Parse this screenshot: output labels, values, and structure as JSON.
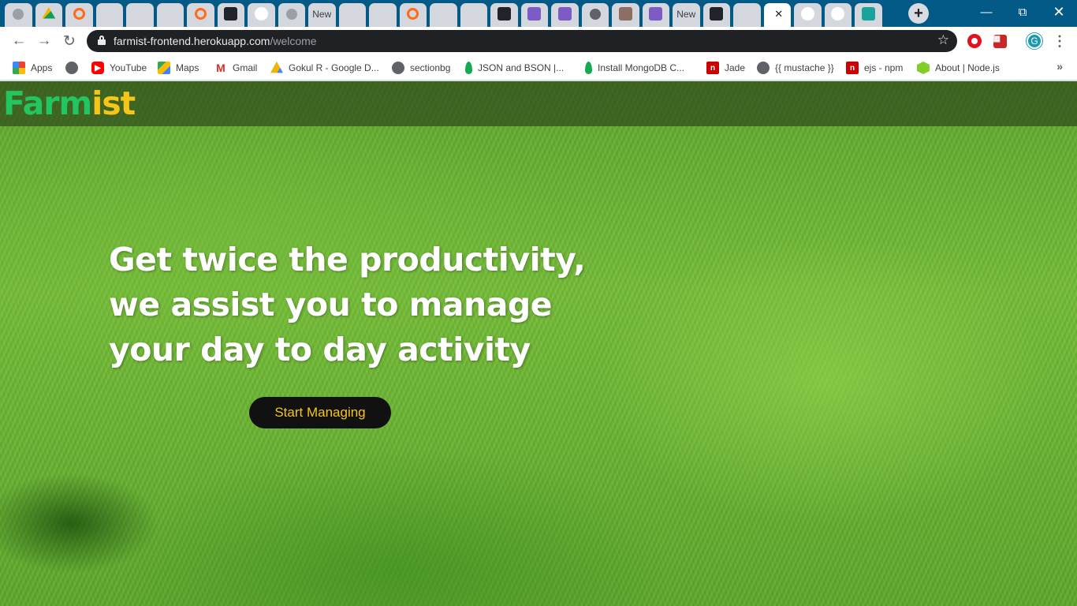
{
  "tabs": [
    {
      "icon": "globe-icon",
      "color": "#9aa0a6",
      "glyph": ""
    },
    {
      "icon": "drive-icon",
      "color": "#f4b400",
      "glyph": ""
    },
    {
      "icon": "codepen-orange-icon",
      "color": "#ff6b1a",
      "glyph": ""
    },
    {
      "icon": "gmail-icon",
      "color": "#d93025",
      "glyph": "M"
    },
    {
      "icon": "gmail-icon",
      "color": "#d93025",
      "glyph": "M"
    },
    {
      "icon": "gmail-icon",
      "color": "#d93025",
      "glyph": "M"
    },
    {
      "icon": "codepen-orange-icon",
      "color": "#ff6b1a",
      "glyph": ""
    },
    {
      "icon": "react-dark-icon",
      "color": "#20232a",
      "glyph": "⚛"
    },
    {
      "icon": "google-icon",
      "color": "#ffffff",
      "glyph": "G"
    },
    {
      "icon": "globe-icon",
      "color": "#9aa0a6",
      "glyph": ""
    },
    {
      "icon": "new-tab",
      "color": "",
      "glyph": "",
      "text": "New"
    },
    {
      "icon": "gmail-icon",
      "color": "#d93025",
      "glyph": "M"
    },
    {
      "icon": "gmail-icon",
      "color": "#d93025",
      "glyph": "M"
    },
    {
      "icon": "codepen-orange-icon",
      "color": "#ff6b1a",
      "glyph": ""
    },
    {
      "icon": "stackoverflow-icon",
      "color": "#f48024",
      "glyph": "≡"
    },
    {
      "icon": "diamond-icon",
      "color": "#26c6b0",
      "glyph": "◆"
    },
    {
      "icon": "react-dark-icon",
      "color": "#20232a",
      "glyph": "⚛"
    },
    {
      "icon": "hackerrank-icon",
      "color": "#7c5cc4",
      "glyph": "H"
    },
    {
      "icon": "hackerrank-icon",
      "color": "#7c5cc4",
      "glyph": "H"
    },
    {
      "icon": "globe-icon",
      "color": "#5f6368",
      "glyph": ""
    },
    {
      "icon": "monkey-icon",
      "color": "#8d6e63",
      "glyph": "☺"
    },
    {
      "icon": "hackerrank-icon",
      "color": "#7c5cc4",
      "glyph": "H"
    },
    {
      "icon": "new-tab",
      "color": "",
      "glyph": "",
      "text": "New"
    },
    {
      "icon": "react-dark-icon",
      "color": "#20232a",
      "glyph": "⚛"
    },
    {
      "icon": "stackoverflow-icon",
      "color": "#f48024",
      "glyph": "≡"
    },
    {
      "icon": "active-tab",
      "color": "",
      "glyph": "",
      "active": true
    },
    {
      "icon": "google-icon",
      "color": "#ffffff",
      "glyph": "G"
    },
    {
      "icon": "google-icon",
      "color": "#ffffff",
      "glyph": "G"
    },
    {
      "icon": "canva-icon",
      "color": "#1aa39a",
      "glyph": "C"
    }
  ],
  "toolbar": {
    "url_host": "farmist-frontend.herokuapp.com",
    "url_path": "/welcome",
    "profile_initial": "G"
  },
  "bookmarks": [
    {
      "label": "Apps",
      "icon": "apps-grid-icon"
    },
    {
      "label": "",
      "icon": "globe-icon"
    },
    {
      "label": "YouTube",
      "icon": "youtube-icon"
    },
    {
      "label": "Maps",
      "icon": "maps-icon"
    },
    {
      "label": "Gmail",
      "icon": "gmail-icon"
    },
    {
      "label": "Gokul R - Google D...",
      "icon": "drive-icon"
    },
    {
      "label": "sectionbg",
      "icon": "globe-icon"
    },
    {
      "label": "JSON and BSON |...",
      "icon": "mongodb-leaf-icon"
    },
    {
      "label": "Install MongoDB C...",
      "icon": "mongodb-leaf-icon"
    },
    {
      "label": "Jade",
      "icon": "npm-icon"
    },
    {
      "label": "{{ mustache }}",
      "icon": "globe-icon"
    },
    {
      "label": "ejs - npm",
      "icon": "npm-icon"
    },
    {
      "label": "About | Node.js",
      "icon": "nodejs-icon"
    }
  ],
  "page": {
    "brand_part1": "Farm",
    "brand_part2": "ist",
    "brand_color1": "#22c55e",
    "brand_color2": "#f5c518",
    "hero_lines": [
      "Get twice the productivity,",
      "we assist you to manage",
      "your day to day activity"
    ],
    "cta_label": "Start Managing"
  }
}
